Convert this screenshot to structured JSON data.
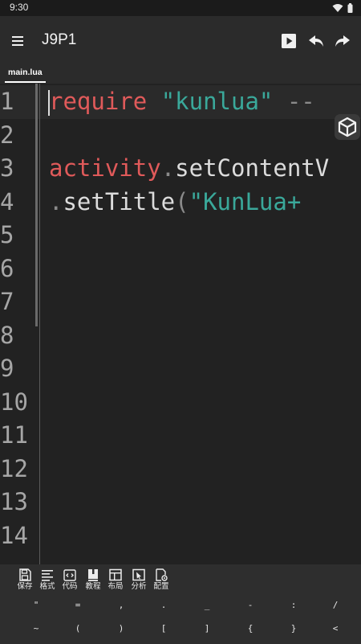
{
  "status": {
    "time": "9:30",
    "icons": [
      "wifi-icon",
      "battery-icon"
    ]
  },
  "app_bar": {
    "title": "J9P1",
    "icons": [
      "menu-icon",
      "run-icon",
      "undo-icon",
      "redo-icon"
    ]
  },
  "tabs": [
    {
      "label": "main.lua",
      "active": true
    }
  ],
  "editor": {
    "line_numbers": [
      "1",
      "2",
      "3",
      "4",
      "5",
      "6",
      "7",
      "8",
      "9",
      "10",
      "11",
      "12",
      "13",
      "14"
    ],
    "lines": [
      [
        {
          "text": "require",
          "role": "keyword"
        },
        {
          "text": " ",
          "role": "plain"
        },
        {
          "text": "\"kunlua\"",
          "role": "string"
        },
        {
          "text": " --",
          "role": "comment"
        }
      ],
      [],
      [
        {
          "text": "activity",
          "role": "keyword"
        },
        {
          "text": ".",
          "role": "punct"
        },
        {
          "text": "setContentV",
          "role": "plain"
        }
      ],
      [
        {
          "text": ".",
          "role": "punct"
        },
        {
          "text": "setTitle",
          "role": "plain"
        },
        {
          "text": "(",
          "role": "punct"
        },
        {
          "text": "\"KunLua+",
          "role": "string"
        }
      ],
      [],
      [],
      [],
      [],
      [],
      [],
      [],
      [],
      [],
      []
    ],
    "colors": {
      "keyword": "#e05a5a",
      "string": "#3aa89a",
      "comment": "#8a8a8a",
      "punct": "#8a8a8a",
      "plain": "#dcdcdc"
    },
    "float_button_icon": "cube-icon"
  },
  "toolbar": {
    "items": [
      {
        "label": "保存",
        "icon": "save-icon"
      },
      {
        "label": "格式",
        "icon": "format-icon"
      },
      {
        "label": "代码",
        "icon": "code-icon"
      },
      {
        "label": "教程",
        "icon": "book-icon"
      },
      {
        "label": "布局",
        "icon": "layout-icon"
      },
      {
        "label": "分析",
        "icon": "analyze-icon"
      },
      {
        "label": "配置",
        "icon": "config-icon"
      }
    ]
  },
  "symbols": {
    "row1": [
      "\"",
      "=",
      ",",
      ".",
      "_",
      "-",
      ":",
      "/"
    ],
    "row2": [
      "~",
      "(",
      ")",
      "[",
      "]",
      "{",
      "}",
      "<"
    ]
  }
}
